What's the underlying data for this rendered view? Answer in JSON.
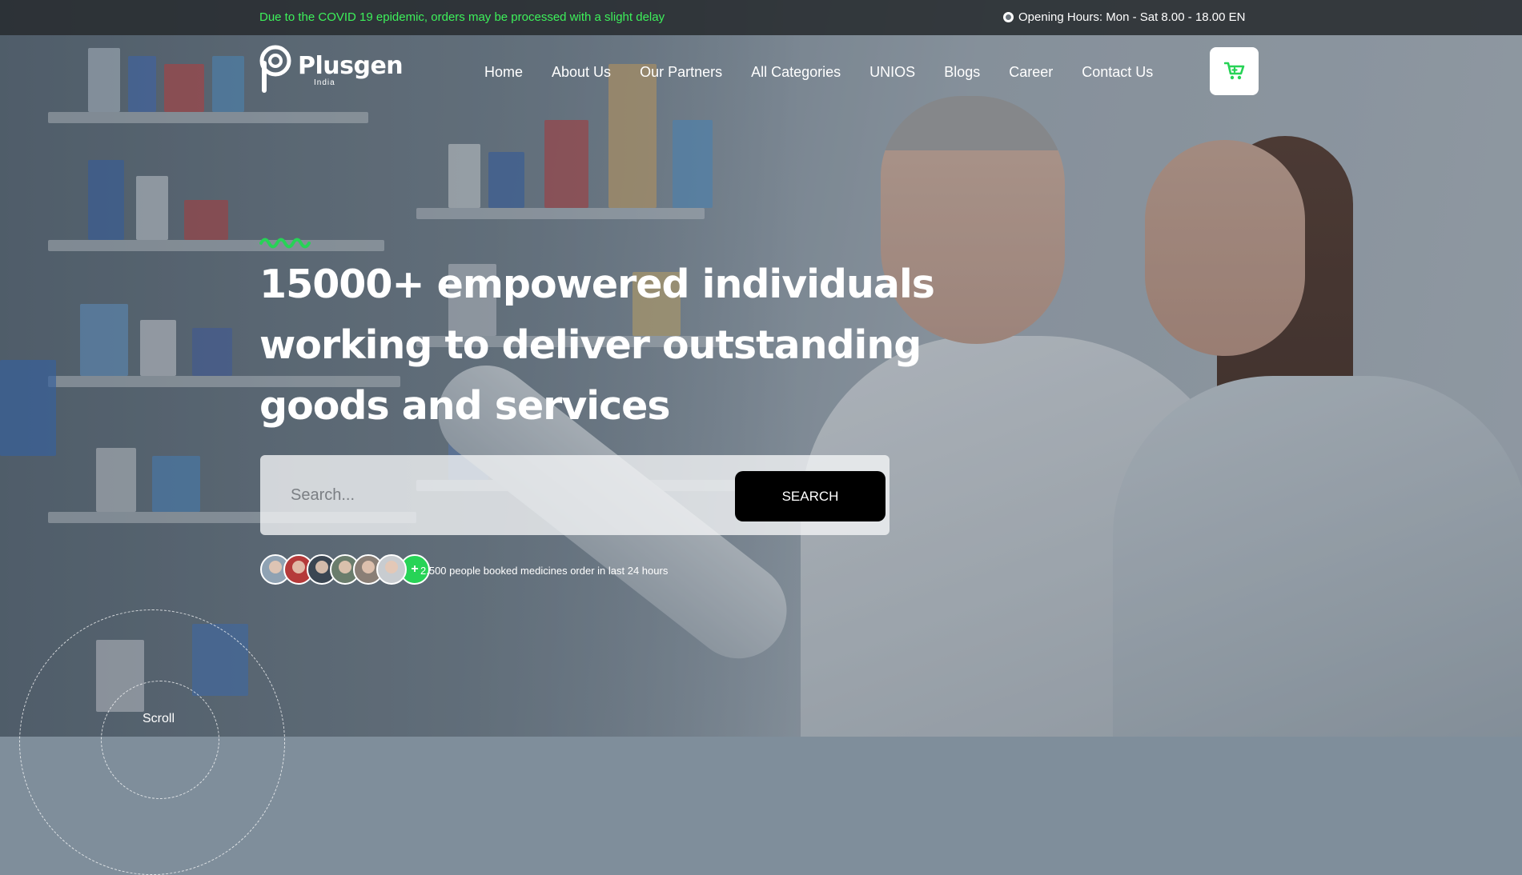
{
  "topbar": {
    "notice": "Due to the COVID 19 epidemic, orders may be processed with a slight delay",
    "hours": "Opening Hours: Mon - Sat 8.00 - 18.00 EN"
  },
  "header": {
    "logo_name": "Plusgen",
    "logo_sub": "India",
    "nav": [
      {
        "label": "Home"
      },
      {
        "label": "About Us"
      },
      {
        "label": "Our Partners"
      },
      {
        "label": "All Categories"
      },
      {
        "label": "UNIOS"
      },
      {
        "label": "Blogs"
      },
      {
        "label": "Career"
      },
      {
        "label": "Contact Us"
      }
    ],
    "cart_icon": "cart-icon"
  },
  "hero": {
    "headline": "15000+ empowered individuals working to deliver outstanding goods and services",
    "search": {
      "placeholder": "Search...",
      "button_label": "SEARCH"
    },
    "avatar_count": 6,
    "avatar_more": "+",
    "booked_text": "2,500 people booked medicines order in last 24 hours",
    "scroll_label": "Scroll"
  },
  "colors": {
    "accent_green": "#27d356",
    "notice_green": "#3df05a",
    "button_black": "#000000"
  }
}
